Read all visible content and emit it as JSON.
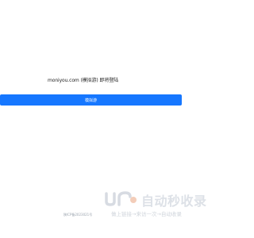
{
  "notice": {
    "text": "moniyou.com (模拟游) 即将登陆"
  },
  "visit_button": {
    "label": "模拟游",
    "color": "#1677ff"
  },
  "watermark": {
    "title": "自动秒收录",
    "slogan": "做上链接→来访一次→自动收录",
    "logo_icon": "jr-logo-icon"
  },
  "footer": {
    "text": "陕ICP备2023021号"
  }
}
